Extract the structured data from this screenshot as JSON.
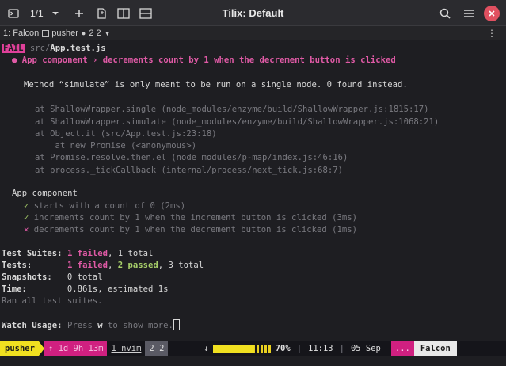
{
  "titlebar": {
    "session_count": "1/1",
    "title": "Tilix: Default",
    "icons": [
      "terminal-icon",
      "chevron-down-icon",
      "plus-icon",
      "detach-icon",
      "split-right-icon",
      "split-down-icon",
      "search-icon",
      "menu-icon",
      "close-icon"
    ]
  },
  "sessionbar": {
    "terminal_name": "1: Falcon",
    "user": "pusher",
    "badge": "2 2"
  },
  "terminal": {
    "fail_badge": "FAIL",
    "fail_path_prefix": "src/",
    "fail_path_file": "App.test.js",
    "failure_title": "● App component › decrements count by 1 when the decrement button is clicked",
    "error_message": "Method “simulate” is only meant to be run on a single node. 0 found instead.",
    "stack": [
      "at ShallowWrapper.single (node_modules/enzyme/build/ShallowWrapper.js:1815:17)",
      "at ShallowWrapper.simulate (node_modules/enzyme/build/ShallowWrapper.js:1068:21)",
      "at Object.it (src/App.test.js:23:18)",
      "    at new Promise (<anonymous>)",
      "at Promise.resolve.then.el (node_modules/p-map/index.js:46:16)",
      "at process._tickCallback (internal/process/next_tick.js:68:7)"
    ],
    "suite_name": "App component",
    "tests": [
      {
        "mark": "✓",
        "text": "starts with a count of 0 (2ms)"
      },
      {
        "mark": "✓",
        "text": "increments count by 1 when the increment button is clicked (3ms)"
      },
      {
        "mark": "✕",
        "text": "decrements count by 1 when the decrement button is clicked (1ms)"
      }
    ],
    "summary": {
      "suites_label": "Test Suites:",
      "suites_failed": "1 failed",
      "suites_rest": ", 1 total",
      "tests_label": "Tests:",
      "tests_failed": "1 failed",
      "tests_passed": "2 passed",
      "tests_total": ", 3 total",
      "snapshots_label": "Snapshots:",
      "snapshots_value": "0 total",
      "time_label": "Time:",
      "time_value": "0.861s, estimated 1s",
      "ran_all": "Ran all test suites."
    },
    "watch_label": "Watch Usage:",
    "watch_prefix": "Press ",
    "watch_key": "w",
    "watch_suffix": " to show more."
  },
  "statusbar": {
    "session": "pusher",
    "uptime": "↑ 1d 9h 13m",
    "window1": "1 nvim",
    "window2": "2 2",
    "download_icon": "↓",
    "battery_percent": "70%",
    "battery_level": 0.7,
    "time": "11:13",
    "date": "05 Sep",
    "dots": "...",
    "host": "Falcon"
  },
  "colors": {
    "accent_pink": "#e0409a",
    "accent_yellow": "#f0e020",
    "pass_green": "#a8d06a",
    "close_red": "#e05060"
  }
}
